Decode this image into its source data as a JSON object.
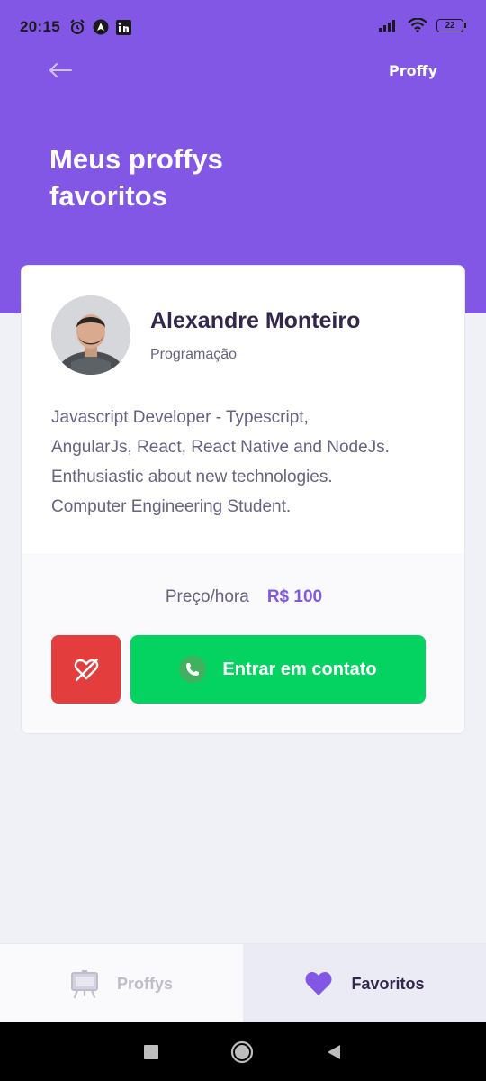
{
  "status_bar": {
    "time": "20:15",
    "battery": "22",
    "icons": [
      "alarm-icon",
      "navigation-app-icon",
      "linkedin-icon",
      "signal-icon",
      "wifi-icon",
      "battery-icon"
    ]
  },
  "header": {
    "brand": "Proffy",
    "title_line1": "Meus proffys",
    "title_line2": "favoritos",
    "back_icon": "arrow-left-icon"
  },
  "card": {
    "teacher_name": "Alexandre Monteiro",
    "subject": "Programação",
    "bio_lines": [
      "Javascript Developer - Typescript,",
      "AngularJs, React, React Native and NodeJs.",
      "Enthusiastic about new technologies.",
      "Computer Engineering Student."
    ],
    "price_label": "Preço/hora",
    "price_value": "R$ 100",
    "contact_label": "Entrar em contato",
    "unfavorite_icon": "heart-off-icon",
    "contact_icon": "whatsapp-icon"
  },
  "tabs": [
    {
      "label": "Proffys",
      "icon": "easel-icon",
      "active": false
    },
    {
      "label": "Favoritos",
      "icon": "heart-icon",
      "active": true
    }
  ],
  "colors": {
    "primary": "#8257E5",
    "background": "#F0F0F7",
    "text_title": "#32264D",
    "text_body": "#6A6180",
    "danger": "#E33D3D",
    "success": "#04D361"
  }
}
